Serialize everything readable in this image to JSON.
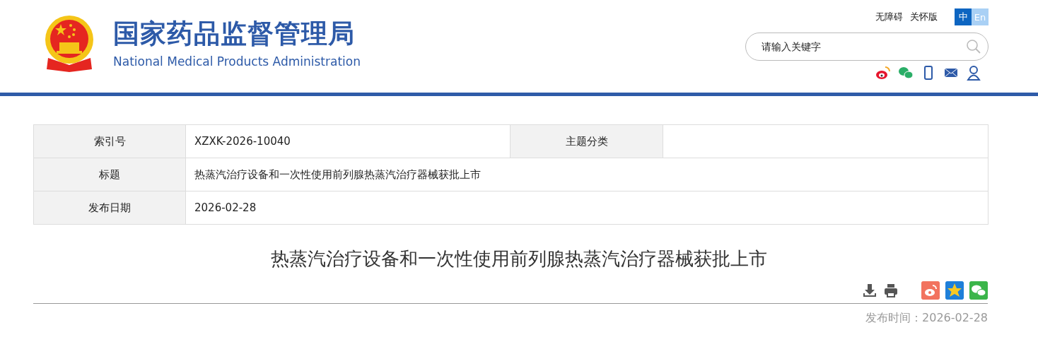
{
  "header": {
    "title_cn": "国家药品监督管理局",
    "title_en": "National Medical Products Administration",
    "top_links": [
      "无障碍",
      "关怀版"
    ],
    "languages": [
      {
        "label": "中",
        "selected": true
      },
      {
        "label": "En",
        "selected": false
      }
    ],
    "search": {
      "placeholder": "请输入关键字"
    }
  },
  "info_table": {
    "rows": [
      {
        "cells": [
          {
            "kind": "label",
            "text": "索引号"
          },
          {
            "kind": "value",
            "text": "XZXK-2026-10040"
          },
          {
            "kind": "label",
            "text": "主题分类"
          },
          {
            "kind": "value"
          }
        ]
      },
      {
        "cells": [
          {
            "kind": "label",
            "text": "标题"
          },
          {
            "kind": "wide",
            "colspan": 3,
            "text": "热蒸汽治疗设备和一次性使用前列腺热蒸汽治疗器械获批上市"
          }
        ]
      },
      {
        "cells": [
          {
            "kind": "label",
            "text": "发布日期"
          },
          {
            "kind": "wide",
            "colspan": 3,
            "text": "2026-02-28"
          }
        ]
      }
    ]
  },
  "article": {
    "title": "热蒸汽治疗设备和一次性使用前列腺热蒸汽治疗器械获批上市",
    "date_label": "发布时间：",
    "date": "2026-02-28"
  }
}
